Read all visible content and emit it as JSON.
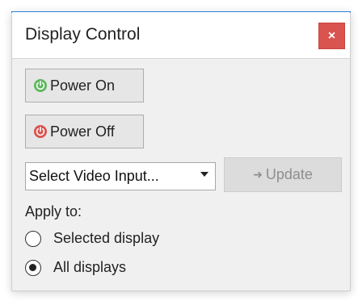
{
  "dialog": {
    "title": "Display Control",
    "close_label": "×"
  },
  "buttons": {
    "power_on": {
      "label": "Power On",
      "icon": "power-icon",
      "icon_color": "#5cb85c"
    },
    "power_off": {
      "label": "Power Off",
      "icon": "power-icon",
      "icon_color": "#d9534f"
    },
    "update": {
      "label": "Update",
      "icon": "arrow-right-icon",
      "enabled": false
    }
  },
  "video_input": {
    "selected": "Select Video Input..."
  },
  "apply_to": {
    "label": "Apply to:",
    "options": [
      {
        "label": "Selected display",
        "checked": false
      },
      {
        "label": "All displays",
        "checked": true
      }
    ]
  },
  "colors": {
    "accent": "#2d7fd8",
    "close_bg": "#d9534f",
    "power_on": "#5cb85c",
    "power_off": "#d9534f"
  }
}
